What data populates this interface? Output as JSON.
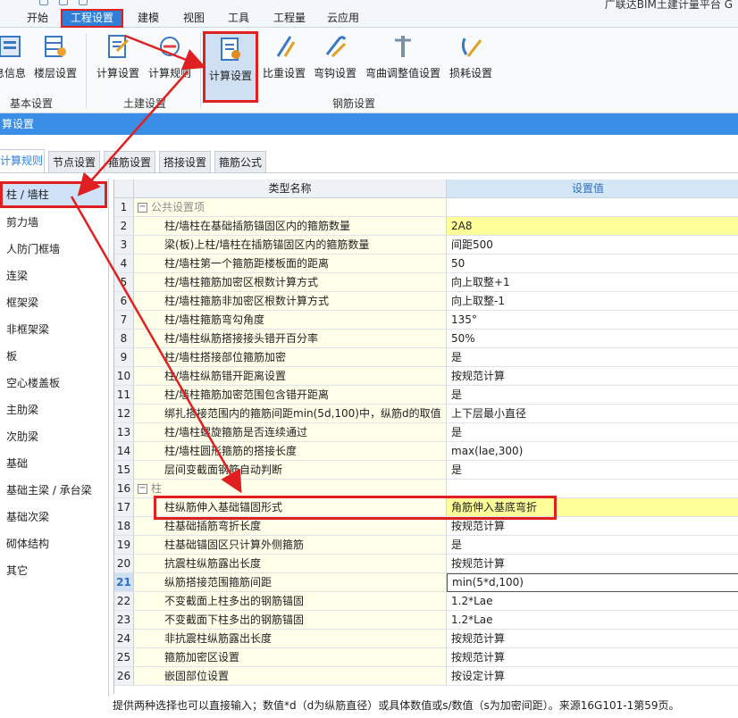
{
  "menu": {
    "title_fragment": "广联达BIM土建计量平台 G",
    "items": [
      {
        "id": "start",
        "label": "开始"
      },
      {
        "id": "project",
        "label": "工程设置"
      },
      {
        "id": "model",
        "label": "建模"
      },
      {
        "id": "view",
        "label": "视图"
      },
      {
        "id": "tools",
        "label": "工具"
      },
      {
        "id": "quantity",
        "label": "工程量"
      },
      {
        "id": "cloud",
        "label": "云应用"
      }
    ],
    "active": "project"
  },
  "ribbon": {
    "groups": {
      "basic": {
        "label": "基本设置",
        "buttons": [
          {
            "label": "息信息",
            "icon": "info-icon"
          },
          {
            "label": "楼层设置",
            "icon": "floor-icon"
          }
        ]
      },
      "civil": {
        "label": "土建设置",
        "buttons": [
          {
            "label": "计算设置",
            "icon": "calc-setting-icon"
          },
          {
            "label": "计算规则",
            "icon": "calc-rule-icon"
          }
        ]
      },
      "rebar": {
        "label": "钢筋设置",
        "buttons": [
          {
            "label": "计算设置",
            "icon": "calc-setting-icon"
          },
          {
            "label": "比重设置",
            "icon": "weight-icon"
          },
          {
            "label": "弯钩设置",
            "icon": "hook-icon"
          },
          {
            "label": "弯曲调整值设置",
            "icon": "bend-icon"
          },
          {
            "label": "损耗设置",
            "icon": "loss-icon"
          }
        ]
      }
    }
  },
  "dialog": {
    "title": "算设置"
  },
  "tabs": [
    {
      "label": "计算规则",
      "active": true
    },
    {
      "label": "节点设置"
    },
    {
      "label": "箍筋设置"
    },
    {
      "label": "搭接设置"
    },
    {
      "label": "箍筋公式"
    }
  ],
  "left_list": [
    "柱 / 墙柱",
    "剪力墙",
    "人防门框墙",
    "连梁",
    "框架梁",
    "非框架梁",
    "板",
    "空心楼盖板",
    "主肋梁",
    "次肋梁",
    "基础",
    "基础主梁 / 承台梁",
    "基础次梁",
    "砌体结构",
    "其它"
  ],
  "grid": {
    "header_name": "类型名称",
    "header_value": "设置值",
    "rows": [
      {
        "num": "1",
        "name": "公共设置项",
        "value": "",
        "group": true
      },
      {
        "num": "2",
        "name": "柱/墙柱在基础插筋锚固区内的箍筋数量",
        "value": "2A8",
        "yellow": true
      },
      {
        "num": "3",
        "name": "梁(板)上柱/墙柱在插筋锚固区内的箍筋数量",
        "value": "间距500"
      },
      {
        "num": "4",
        "name": "柱/墙柱第一个箍筋距楼板面的距离",
        "value": "50"
      },
      {
        "num": "5",
        "name": "柱/墙柱箍筋加密区根数计算方式",
        "value": "向上取整+1"
      },
      {
        "num": "6",
        "name": "柱/墙柱箍筋非加密区根数计算方式",
        "value": "向上取整-1"
      },
      {
        "num": "7",
        "name": "柱/墙柱箍筋弯勾角度",
        "value": "135°"
      },
      {
        "num": "8",
        "name": "柱/墙柱纵筋搭接接头错开百分率",
        "value": "50%"
      },
      {
        "num": "9",
        "name": "柱/墙柱搭接部位箍筋加密",
        "value": "是"
      },
      {
        "num": "10",
        "name": "柱/墙柱纵筋错开距离设置",
        "value": "按规范计算"
      },
      {
        "num": "11",
        "name": "柱/墙柱箍筋加密范围包含错开距离",
        "value": "是"
      },
      {
        "num": "12",
        "name": "绑扎搭接范围内的箍筋间距min(5d,100)中，纵筋d的取值",
        "value": "上下层最小直径"
      },
      {
        "num": "13",
        "name": "柱/墙柱螺旋箍筋是否连续通过",
        "value": "是"
      },
      {
        "num": "14",
        "name": "柱/墙柱圆形箍筋的搭接长度",
        "value": "max(lae,300)"
      },
      {
        "num": "15",
        "name": "层间变截面钢筋自动判断",
        "value": "是"
      },
      {
        "num": "16",
        "name": "柱",
        "value": "",
        "group": true
      },
      {
        "num": "17",
        "name": "柱纵筋伸入基础锚固形式",
        "value": "角筋伸入基底弯折",
        "yellow": true
      },
      {
        "num": "18",
        "name": "柱基础插筋弯折长度",
        "value": "按规范计算"
      },
      {
        "num": "19",
        "name": "柱基础锚固区只计算外侧箍筋",
        "value": "是"
      },
      {
        "num": "20",
        "name": "抗震柱纵筋露出长度",
        "value": "按规范计算"
      },
      {
        "num": "21",
        "name": "纵筋搭接范围箍筋间距",
        "value": "min(5*d,100)",
        "selected": true
      },
      {
        "num": "22",
        "name": "不变截面上柱多出的钢筋锚固",
        "value": "1.2*Lae"
      },
      {
        "num": "23",
        "name": "不变截面下柱多出的钢筋锚固",
        "value": "1.2*Lae"
      },
      {
        "num": "24",
        "name": "非抗震柱纵筋露出长度",
        "value": "按规范计算"
      },
      {
        "num": "25",
        "name": "箍筋加密区设置",
        "value": "按规范计算"
      },
      {
        "num": "26",
        "name": "嵌固部位设置",
        "value": "按设定计算"
      }
    ]
  },
  "status": {
    "text": "提供两种选择也可以直接输入；数值*d（d为纵筋直径）或具体数值或s/数值（s为加密间距）。来源16G101-1第59页。"
  },
  "colors": {
    "accent": "#2f7fd6",
    "highlight": "#e02020",
    "title_bar": "#3a8ee6",
    "yellow_cell": "#ffff99",
    "name_cell": "#ffffea"
  }
}
